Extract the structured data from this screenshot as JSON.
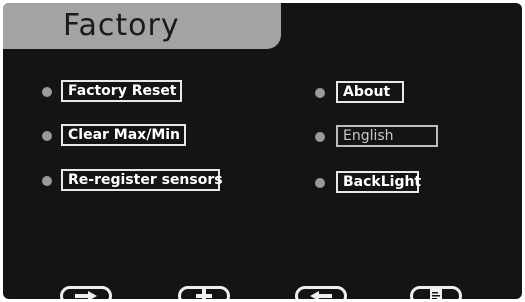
{
  "header": {
    "title": "Factory"
  },
  "menu": {
    "left": [
      {
        "label": "Factory Reset"
      },
      {
        "label": "Clear Max/Min"
      },
      {
        "label": "Re-register sensors"
      }
    ],
    "right": [
      {
        "label": "About"
      },
      {
        "label": "English"
      },
      {
        "label": "BackLight"
      }
    ]
  },
  "softkeys": [
    {
      "icon": "arrow-right-icon"
    },
    {
      "icon": "plus-icon"
    },
    {
      "icon": "arrow-left-icon"
    },
    {
      "icon": "page-icon"
    }
  ],
  "colors": {
    "background": "#141414",
    "title_bar": "#a3a3a3",
    "bullet": "#9a9a9a",
    "text": "#ffffff"
  }
}
